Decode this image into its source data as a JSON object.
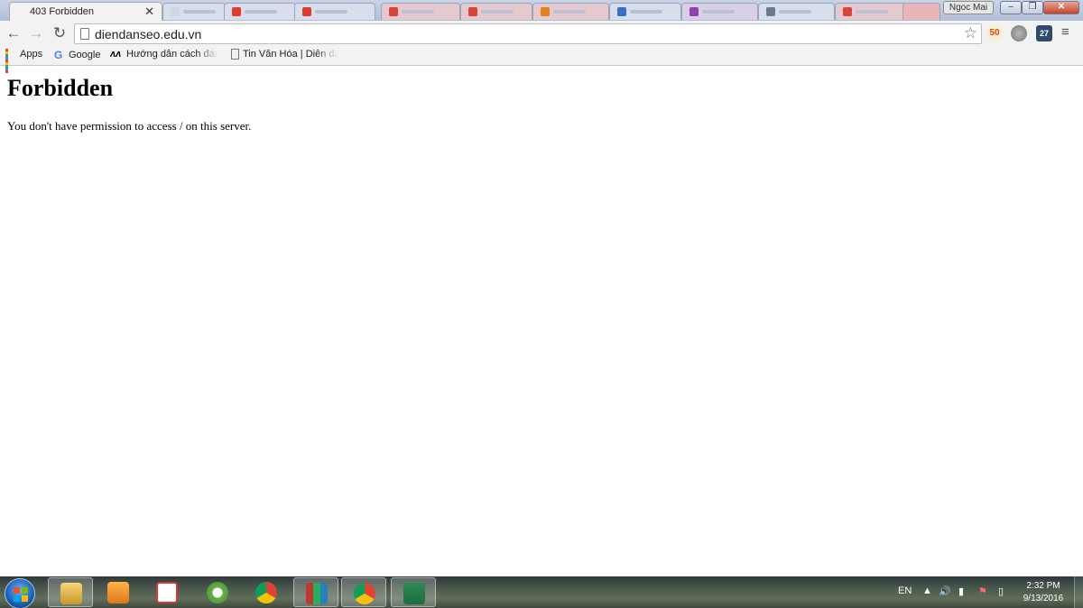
{
  "tab": {
    "title": "403 Forbidden",
    "close": "✕"
  },
  "profile": {
    "name": "Ngoc Mai"
  },
  "window_controls": {
    "minimize": "–",
    "maximize": "❐",
    "close": "✕"
  },
  "nav": {
    "back": "←",
    "forward": "→",
    "reload": "↻"
  },
  "address_bar": {
    "url": "diendanseo.edu.vn",
    "bookmark_star": "☆"
  },
  "extensions": {
    "ext_50": "50",
    "calendar_day": "27"
  },
  "menu": "≡",
  "bookmarks": [
    {
      "label": "Apps",
      "icon": "apps-grid-icon"
    },
    {
      "label": "Google",
      "icon": "google-icon"
    },
    {
      "label": "Hướng dẫn cách đánh",
      "icon": "ahl-icon"
    },
    {
      "label": "Tin Văn Hóa | Diễn đà",
      "icon": "page-icon"
    }
  ],
  "page": {
    "heading": "Forbidden",
    "message": "You don't have permission to access / on this server."
  },
  "taskbar": {
    "language": "EN",
    "time": "2:32 PM",
    "date": "9/13/2016",
    "apps": [
      "file-explorer",
      "media-player",
      "unikey",
      "coc-coc",
      "chrome",
      "winrar",
      "chrome",
      "excel"
    ],
    "active_app": "chrome"
  },
  "colors": {
    "tabstrip": "#c3cde2",
    "toolbar": "#f2f2f2",
    "close_button": "#c7442b",
    "taskbar": "#4c5a4f"
  }
}
